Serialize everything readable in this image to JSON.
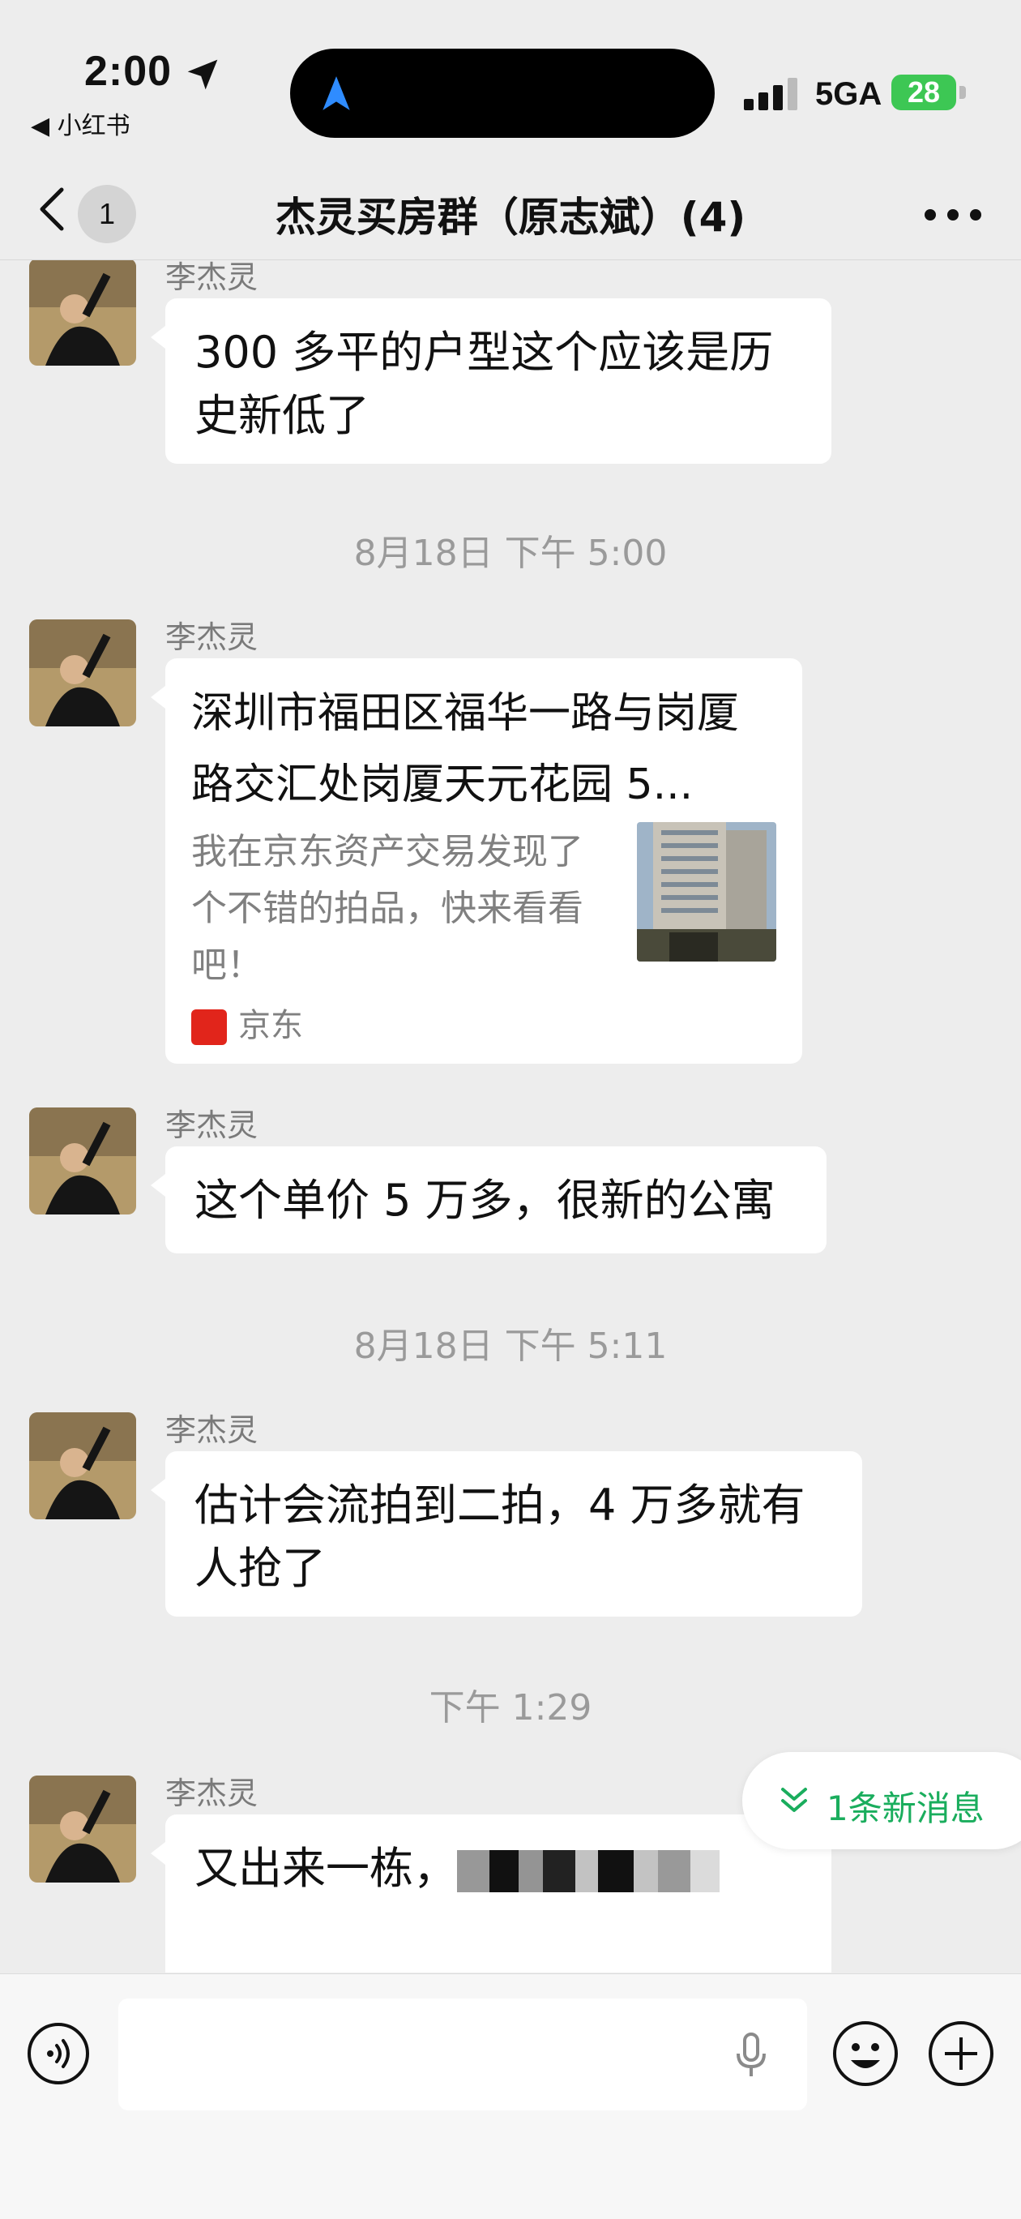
{
  "status_bar": {
    "time": "2:00",
    "back_app": "◀ 小红书",
    "network": "5GA",
    "battery": "28"
  },
  "nav": {
    "unread_count": "1",
    "title": "杰灵买房群（原志斌）(4)"
  },
  "messages": [
    {
      "sender": "李杰灵",
      "text": "300 多平的户型这个应该是历史新低了"
    },
    {
      "timestamp": "8月18日 下午 5:00"
    },
    {
      "sender": "李杰灵",
      "card": {
        "title": "深圳市福田区福华一路与岗厦路交汇处岗厦天元花园 5...",
        "desc": "我在京东资产交易发现了个不错的拍品，快来看看吧！",
        "source": "京东"
      }
    },
    {
      "sender": "李杰灵",
      "text": "这个单价 5 万多，很新的公寓"
    },
    {
      "timestamp": "8月18日 下午 5:11"
    },
    {
      "sender": "李杰灵",
      "text": "估计会流拍到二拍，4 万多就有人抢了"
    },
    {
      "timestamp": "下午 1:29"
    },
    {
      "sender": "李杰灵",
      "text": "又出来一栋，"
    }
  ],
  "new_message_pill": "1条新消息",
  "colors": {
    "accent_green": "#1aad5d",
    "background": "#ededed",
    "jd_red": "#e1251b"
  },
  "icons": [
    "location-arrow-icon",
    "signal-icon",
    "back-chevron-icon",
    "more-icon",
    "voice-icon",
    "mic-icon",
    "emoji-icon",
    "plus-icon",
    "double-chevron-down-icon"
  ]
}
